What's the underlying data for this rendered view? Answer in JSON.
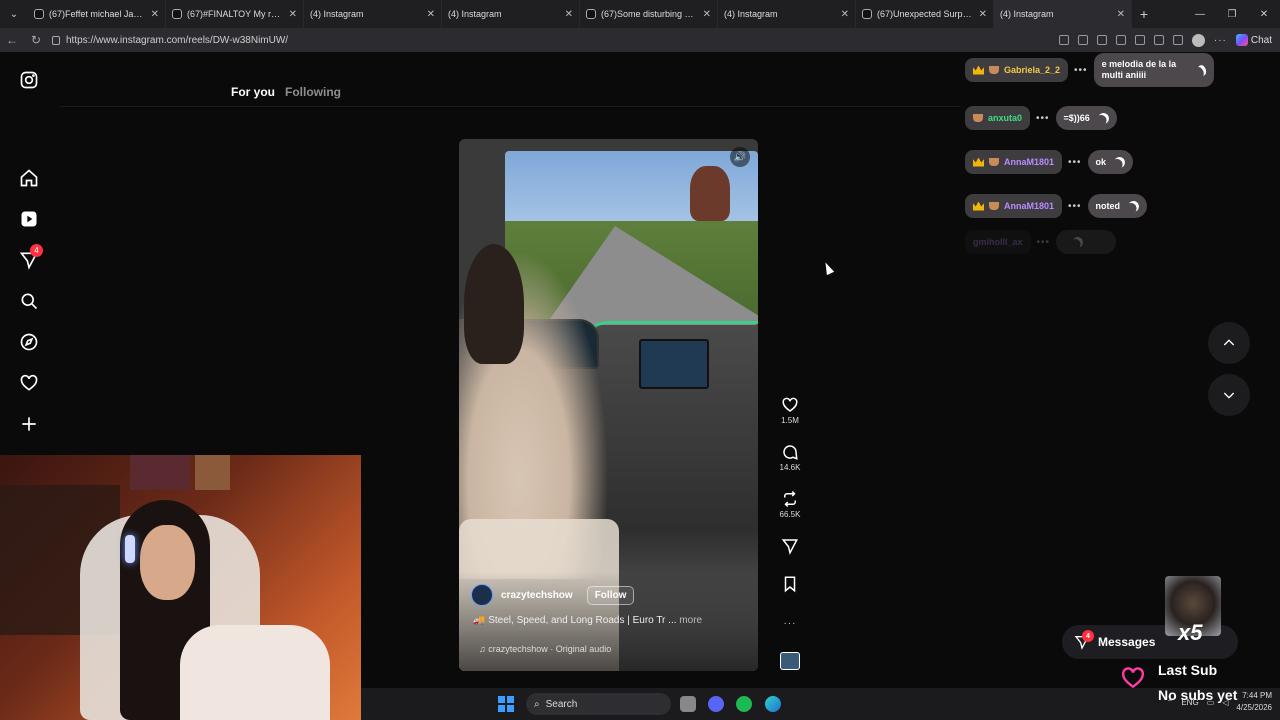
{
  "browser": {
    "tabs": [
      {
        "title": "(67)Feffet michael Jackson 😊",
        "type": "tiktok",
        "active": false
      },
      {
        "title": "(67)#FINALTOY My romanian",
        "type": "tiktok",
        "active": false
      },
      {
        "title": "(4) Instagram",
        "type": "instagram",
        "active": false
      },
      {
        "title": "(4) Instagram",
        "type": "instagram",
        "active": false
      },
      {
        "title": "(67)Some disturbing youtub",
        "type": "tiktok",
        "active": false
      },
      {
        "title": "(4) Instagram",
        "type": "instagram",
        "active": false
      },
      {
        "title": "(67)Unexpected Surprise! | T",
        "type": "tiktok",
        "active": false
      },
      {
        "title": "(4) Instagram",
        "type": "instagram",
        "active": true
      }
    ],
    "url": "https://www.instagram.com/reels/DW-w38NimUW/",
    "chat_label": "Chat"
  },
  "instagram": {
    "notification_count": "4",
    "feed_tabs": {
      "for_you": "For you",
      "following": "Following"
    },
    "reel": {
      "author": "crazytechshow",
      "follow_label": "Follow",
      "caption": "🚚 Steel, Speed, and Long Roads | Euro Tr ...",
      "more_label": "more",
      "audio": "♫ crazytechshow · Original audio"
    },
    "actions": {
      "likes": "1.5M",
      "comments": "14.6K",
      "reposts": "66.5K"
    },
    "messages": {
      "label": "Messages",
      "badge": "4"
    }
  },
  "stream_chat": [
    {
      "user": "Gabriela_2_2",
      "text": "e melodia de la la multi aniiii"
    },
    {
      "user": "anxuta0",
      "text": "=$))66"
    },
    {
      "user": "AnnaM1801",
      "text": "ok"
    },
    {
      "user": "AnnaM1801",
      "text": "noted"
    },
    {
      "user": "gmiholll_ax",
      "text": ""
    }
  ],
  "stream_overlay": {
    "multiplier": "x5",
    "last_sub_title": "Last Sub",
    "last_sub_value": "No subs yet"
  },
  "taskbar": {
    "search_label": "Search",
    "lang": "ENG",
    "time": "7:44 PM",
    "date": "4/25/2026"
  },
  "colors": {
    "accent_notification": "#ff3040",
    "user_gold": "#f2c94c",
    "user_green": "#3ddc84",
    "user_purple": "#b88cff",
    "dash_green": "#27e08a"
  }
}
